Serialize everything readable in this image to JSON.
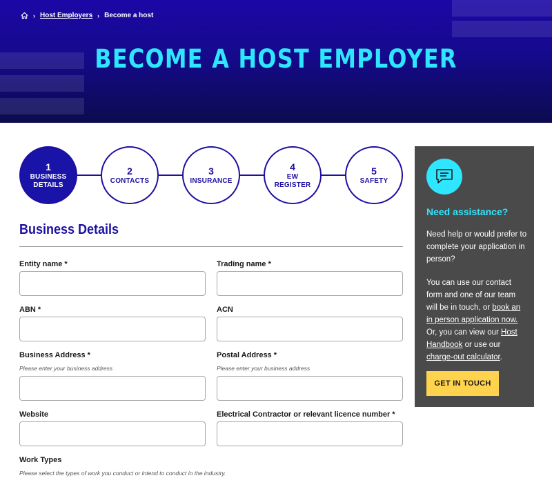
{
  "breadcrumb": {
    "home_icon": "home-icon",
    "items": [
      {
        "label": "Host Employers",
        "link": true
      },
      {
        "label": "Become a host",
        "link": false
      }
    ]
  },
  "hero": {
    "title": "BECOME A HOST EMPLOYER",
    "title_color": "#2ee6ff",
    "background": "#1c07a6"
  },
  "stepper": {
    "steps": [
      {
        "num": "1",
        "label": "BUSINESS DETAILS",
        "active": true
      },
      {
        "num": "2",
        "label": "CONTACTS",
        "active": false
      },
      {
        "num": "3",
        "label": "INSURANCE",
        "active": false
      },
      {
        "num": "4",
        "label": "EW REGISTER",
        "active": false
      },
      {
        "num": "5",
        "label": "SAFETY",
        "active": false
      }
    ]
  },
  "form": {
    "section_title": "Business Details",
    "fields": {
      "entity_name": {
        "label": "Entity name *",
        "value": ""
      },
      "trading_name": {
        "label": "Trading name *",
        "value": ""
      },
      "abn": {
        "label": "ABN *",
        "value": ""
      },
      "acn": {
        "label": "ACN",
        "value": ""
      },
      "business_address": {
        "label": "Business Address *",
        "hint": "Please enter your business address",
        "value": ""
      },
      "postal_address": {
        "label": "Postal Address *",
        "hint": "Please enter your business address",
        "value": ""
      },
      "website": {
        "label": "Website",
        "value": ""
      },
      "licence_number": {
        "label": "Electrical Contractor or relevant licence number *",
        "value": ""
      }
    },
    "work_types": {
      "label": "Work Types",
      "hint": "Please select the types of work you conduct or intend to conduct in the industry."
    }
  },
  "sidebar": {
    "icon": "chat-icon",
    "title": "Need assistance?",
    "para1": "Need help or would prefer to complete your application in person?",
    "para2_a": "You can use our contact form and one of our team will be in touch, or ",
    "link_book": "book an in person application now.",
    "para2_b": " Or, you can view our ",
    "link_handbook": "Host Handbook",
    "para2_c": " or use our ",
    "link_calculator": "charge-out calculator",
    "para2_d": ".",
    "cta_label": "GET IN TOUCH",
    "cta_color": "#ffd34d"
  }
}
